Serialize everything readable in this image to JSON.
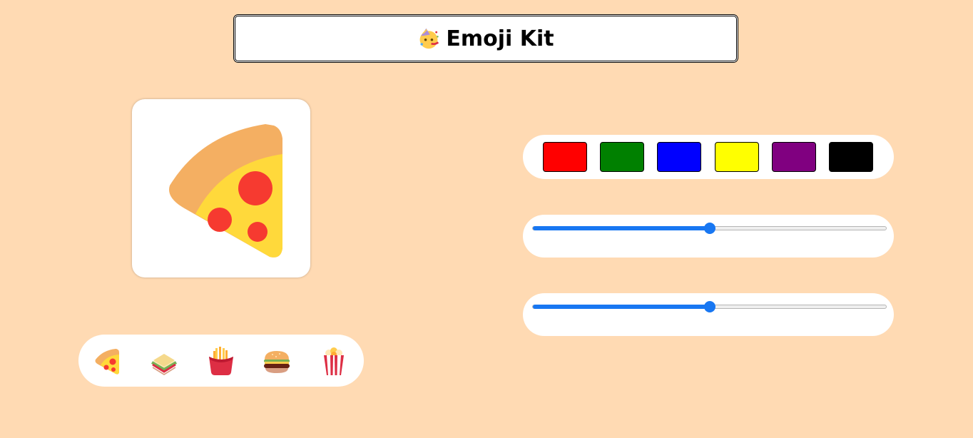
{
  "header": {
    "title": "Emoji Kit",
    "title_icon": "partying-face-icon"
  },
  "preview": {
    "emoji": "pizza-icon"
  },
  "emoji_picker": {
    "options": [
      "pizza-icon",
      "sandwich-icon",
      "french-fries-icon",
      "hamburger-icon",
      "popcorn-icon"
    ],
    "selected": "pizza-icon"
  },
  "color_picker": {
    "swatches": [
      "#FF0000",
      "#008000",
      "#0000FF",
      "#FFFF00",
      "#800080",
      "#000000"
    ]
  },
  "sliders": [
    {
      "name": "slider-1",
      "value": 0.5
    },
    {
      "name": "slider-2",
      "value": 0.5
    }
  ]
}
